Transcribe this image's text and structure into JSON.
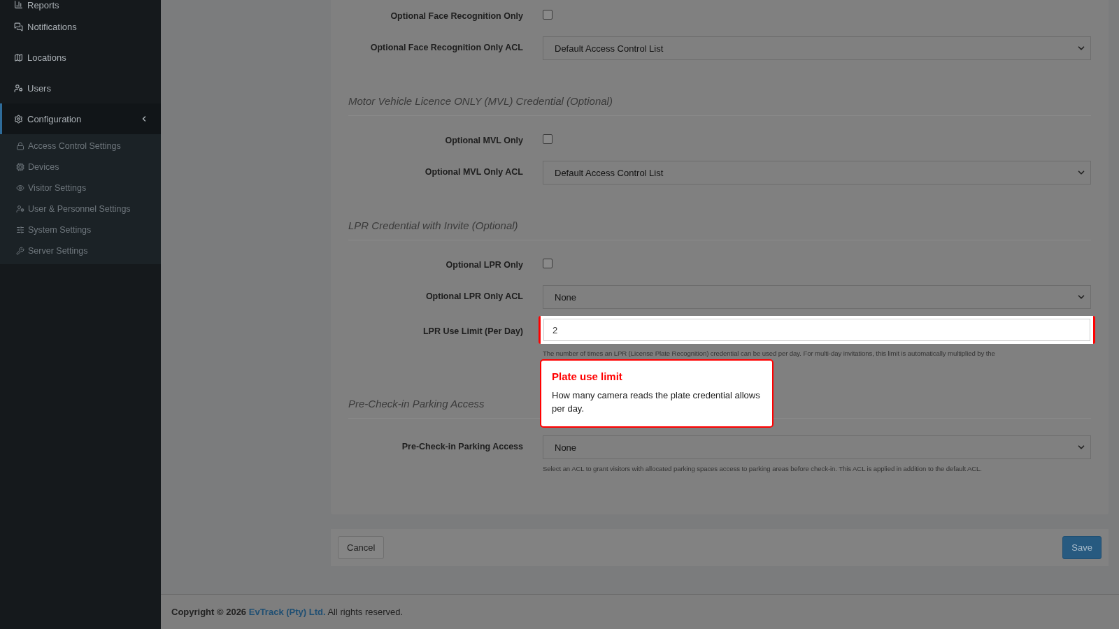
{
  "sidebar": {
    "items": [
      {
        "label": "Reports",
        "selected": false
      },
      {
        "label": "Notifications",
        "selected": false
      },
      {
        "label": "Locations",
        "selected": false
      },
      {
        "label": "Users",
        "selected": false
      },
      {
        "label": "Configuration",
        "selected": true,
        "expanded": true,
        "children": [
          {
            "label": "Access Control Settings",
            "selected": false
          },
          {
            "label": "Devices",
            "selected": false
          },
          {
            "label": "Visitor Settings",
            "selected": false
          },
          {
            "label": "User & Personnel Settings",
            "selected": false
          },
          {
            "label": "System Settings",
            "selected": false
          },
          {
            "label": "Server Settings",
            "selected": false
          }
        ]
      }
    ]
  },
  "sections": [
    {
      "fields": [
        {
          "kind": "checkbox",
          "label": "Optional Face Recognition Only",
          "checked": false
        },
        {
          "kind": "select",
          "label": "Optional Face Recognition Only ACL",
          "value": "Default Access Control List"
        }
      ]
    },
    {
      "title": "Motor Vehicle Licence ONLY (MVL) Credential (Optional)",
      "fields": [
        {
          "kind": "checkbox",
          "label": "Optional MVL Only",
          "checked": false
        },
        {
          "kind": "select",
          "label": "Optional MVL Only ACL",
          "value": "Default Access Control List"
        }
      ]
    },
    {
      "title": "LPR Credential with Invite (Optional)",
      "fields": [
        {
          "kind": "checkbox",
          "label": "Optional LPR Only",
          "checked": false
        },
        {
          "kind": "select",
          "label": "Optional LPR Only ACL",
          "value": "None"
        },
        {
          "kind": "input",
          "label": "LPR Use Limit (Per Day)",
          "value": "2",
          "highlighted": true,
          "help": "The number of times an LPR (License Plate Recognition) credential can be used per day. For multi-day invitations, this limit is automatically multiplied by the",
          "tooltip": {
            "title": "Plate use limit",
            "text": "How many camera reads the plate credential allows per day."
          }
        }
      ]
    },
    {
      "title": "Pre-Check-in Parking Access",
      "fields": [
        {
          "kind": "select",
          "label": "Pre-Check-in Parking Access",
          "value": "None",
          "help": "Select an ACL to grant visitors with allocated parking spaces access to parking areas before check-in. This ACL is applied in addition to the default ACL."
        }
      ]
    }
  ],
  "actions": {
    "cancel": "Cancel",
    "save": "Save"
  },
  "footer": {
    "prefix": "Copyright © 2026",
    "link": "EvTrack (Pty) Ltd.",
    "suffix": "All rights reserved."
  }
}
